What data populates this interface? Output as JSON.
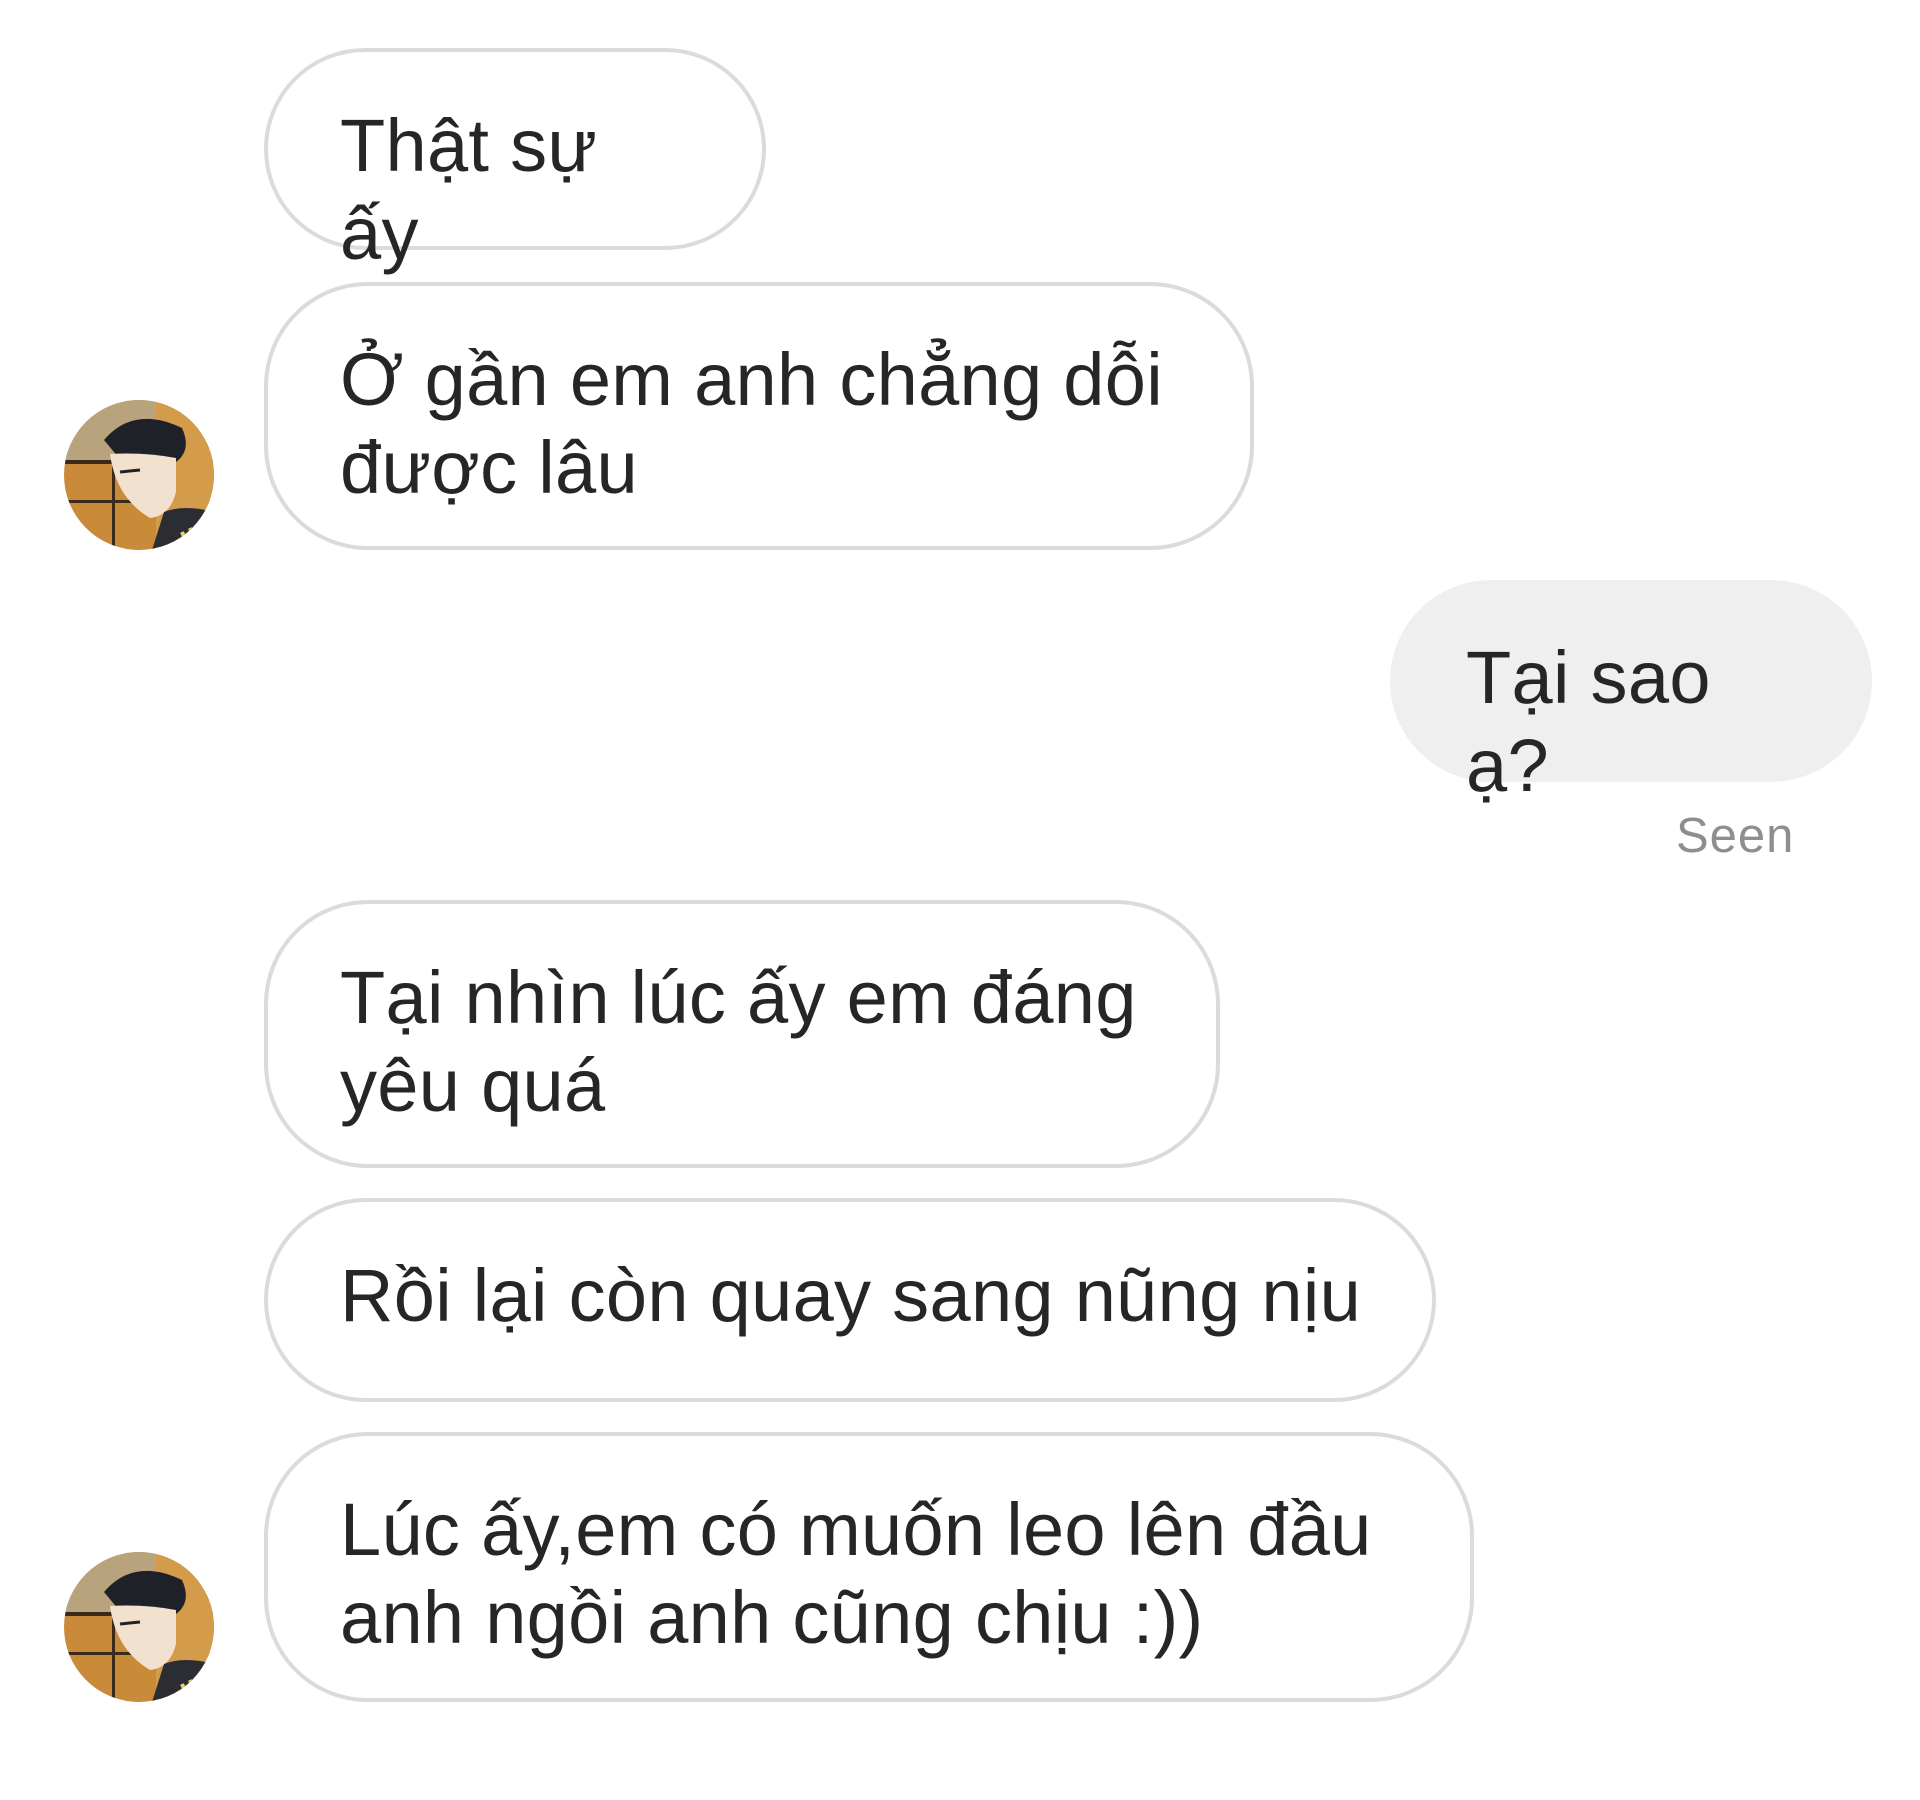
{
  "thread": {
    "messages": [
      {
        "sender": "other",
        "text": "Thật sự ấy"
      },
      {
        "sender": "other",
        "text": "Ở gần em anh chẳng dỗi\nđược lâu"
      },
      {
        "sender": "me",
        "text": "Tại sao ạ?"
      },
      {
        "sender": "other",
        "text": "Tại nhìn lúc ấy em đáng\nyêu quá"
      },
      {
        "sender": "other",
        "text": "Rồi lại còn quay sang nũng nịu"
      },
      {
        "sender": "other",
        "text": "Lúc ấy,em có muốn leo lên đầu\nanh ngồi anh cũng chịu :))"
      }
    ],
    "seen_label": "Seen"
  },
  "colors": {
    "incoming_border": "#dbdbdb",
    "outgoing_bg": "#efefef",
    "text": "#262626",
    "seen_text": "#8e8e8e"
  },
  "icons": {
    "avatar": "contact-avatar"
  }
}
